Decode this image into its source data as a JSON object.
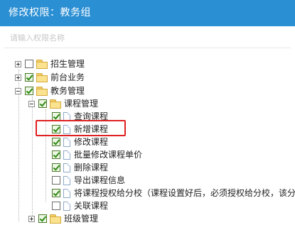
{
  "header": {
    "title": "修改权限：教务组"
  },
  "search": {
    "placeholder": "请输入权限名称"
  },
  "tree": {
    "zhaosheng": "招生管理",
    "qiantai": "前台业务",
    "jiaowu": "教务管理",
    "kecheng": "课程管理",
    "items": [
      "查询课程",
      "新增课程",
      "修改课程",
      "批量修改课程单价",
      "删除课程",
      "导出课程信息",
      "将课程授权给分校（课程设置好后，必须授权给分校，该分",
      "关联课程"
    ],
    "banji": "班级管理"
  }
}
